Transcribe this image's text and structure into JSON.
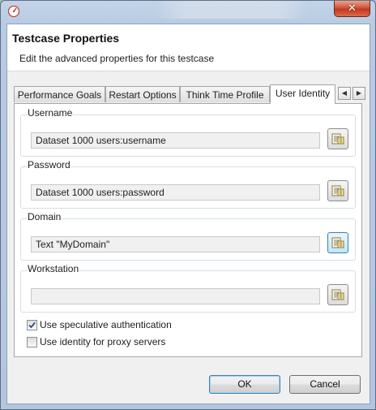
{
  "window": {
    "close_label": "✕"
  },
  "header": {
    "title": "Testcase Properties",
    "description": "Edit the advanced properties for this testcase"
  },
  "tabs": [
    {
      "label": "Performance Goals",
      "active": false
    },
    {
      "label": "Restart Options",
      "active": false
    },
    {
      "label": "Think Time Profile",
      "active": false
    },
    {
      "label": "User Identity",
      "active": true
    }
  ],
  "tab_scroll": {
    "left": "◀",
    "right": "▶"
  },
  "user_identity": {
    "username": {
      "label": "Username",
      "value": "Dataset 1000 users:username"
    },
    "password": {
      "label": "Password",
      "value": "Dataset 1000 users:password"
    },
    "domain": {
      "label": "Domain",
      "value": "Text \"MyDomain\""
    },
    "workstation": {
      "label": "Workstation",
      "value": ""
    }
  },
  "options": {
    "speculative_auth": {
      "label": "Use speculative authentication",
      "checked": true
    },
    "proxy_identity": {
      "label": "Use identity for proxy servers",
      "checked": false
    }
  },
  "buttons": {
    "ok": "OK",
    "cancel": "Cancel"
  },
  "icons": {
    "title": "dialog-app-icon",
    "browse": "dataset-browse-icon"
  }
}
